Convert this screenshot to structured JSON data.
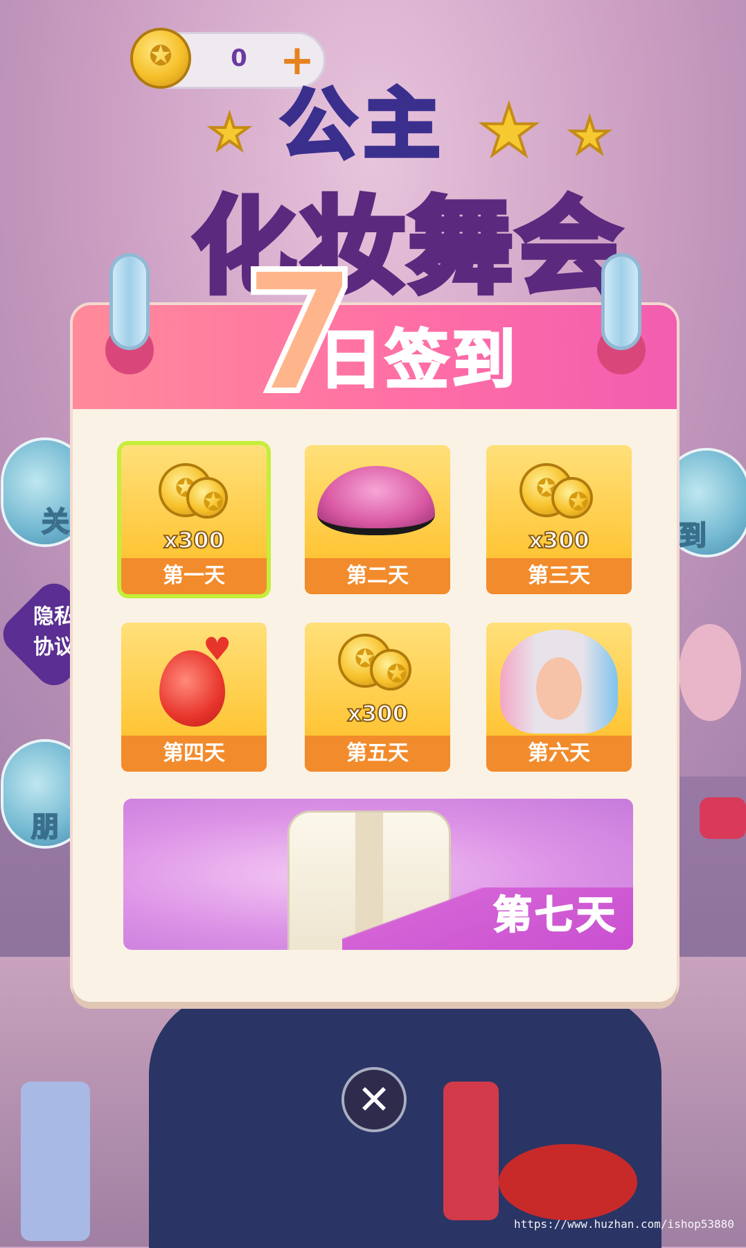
{
  "currency": {
    "count": "0",
    "add_label": "+"
  },
  "logo": {
    "top": "公主",
    "main": "化妆舞会"
  },
  "signin": {
    "title_number": "7",
    "title_text": "日签到"
  },
  "rewards": [
    {
      "day": "第一天",
      "amount": "x300",
      "item": "coin",
      "active": true
    },
    {
      "day": "第二天",
      "amount": "",
      "item": "eyeshadow",
      "active": false
    },
    {
      "day": "第三天",
      "amount": "x300",
      "item": "coin",
      "active": false
    },
    {
      "day": "第四天",
      "amount": "",
      "item": "fruit",
      "active": false
    },
    {
      "day": "第五天",
      "amount": "x300",
      "item": "coin",
      "active": false
    },
    {
      "day": "第六天",
      "amount": "",
      "item": "hair",
      "active": false
    }
  ],
  "day7": {
    "label": "第七天",
    "item": "jacket"
  },
  "side_buttons": {
    "left_top": "关",
    "right_top": "到",
    "left_bottom": "朋"
  },
  "privacy": {
    "line1": "隐私",
    "line2": "协议"
  },
  "close": {
    "label": "✕"
  },
  "watermark": "https://www.huzhan.com/ishop53880",
  "colors": {
    "header_pink": "#ff6fa5",
    "cell_yellow": "#ffc73a",
    "label_orange": "#f28b2c",
    "active_green": "#c5ee3a"
  }
}
